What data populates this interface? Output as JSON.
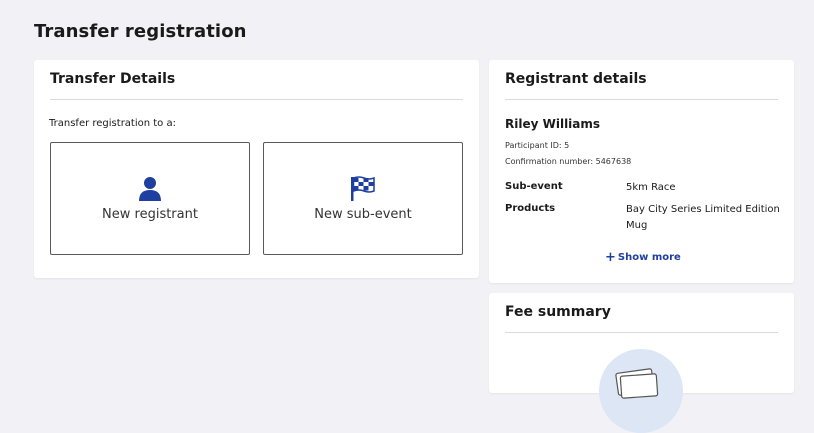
{
  "page": {
    "title": "Transfer registration"
  },
  "transfer": {
    "title": "Transfer Details",
    "prompt": "Transfer registration to a:",
    "options": [
      {
        "label": "New registrant",
        "icon": "person-icon"
      },
      {
        "label": "New sub-event",
        "icon": "checkered-flag-icon"
      }
    ]
  },
  "registrant": {
    "title": "Registrant details",
    "name": "Riley Williams",
    "participant_id": "Participant ID: 5",
    "confirmation": "Confirmation number: 5467638",
    "sub_event_label": "Sub-event",
    "sub_event_value": "5km Race",
    "products_label": "Products",
    "products_value": "Bay City Series Limited Edition Mug",
    "show_more": "Show more"
  },
  "fee": {
    "title": "Fee summary"
  },
  "colors": {
    "accent": "#1f3fa0",
    "background": "#f2f2f6"
  }
}
